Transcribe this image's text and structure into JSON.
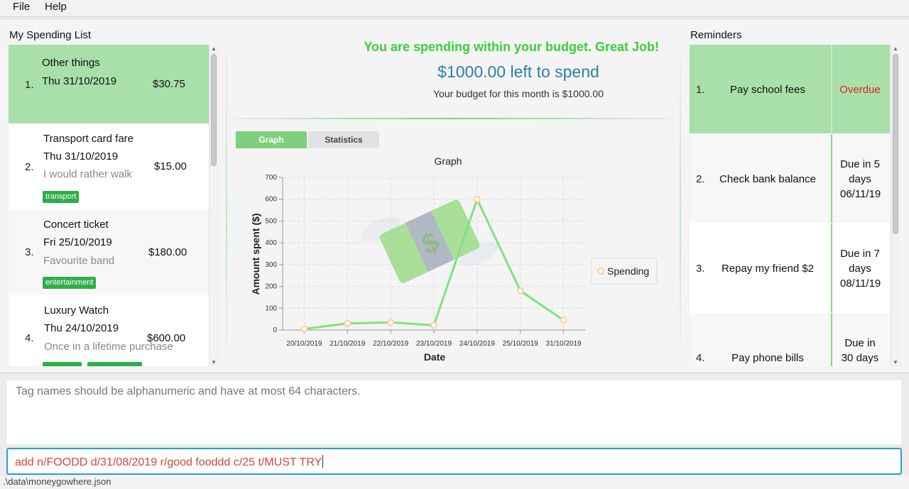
{
  "menu": {
    "file": "File",
    "help": "Help"
  },
  "spending": {
    "title": "My Spending List",
    "items": [
      {
        "index": "1.",
        "name": "Other things",
        "date": "Thu 31/10/2019",
        "remark": "",
        "cost": "$30.75",
        "tags": []
      },
      {
        "index": "2.",
        "name": "Transport card fare",
        "date": "Thu 31/10/2019",
        "remark": "I would rather walk",
        "cost": "$15.00",
        "tags": [
          "transport"
        ]
      },
      {
        "index": "3.",
        "name": "Concert ticket",
        "date": "Fri 25/10/2019",
        "remark": "Favourite band",
        "cost": "$180.00",
        "tags": [
          "entertainment"
        ]
      },
      {
        "index": "4.",
        "name": "Luxury Watch",
        "date": "Thu 24/10/2019",
        "remark": "Once in a lifetime purchase",
        "cost": "$600.00",
        "tags": []
      }
    ],
    "selected_color": "#a9dfa9",
    "tag_color": "#2eae4a"
  },
  "budget": {
    "status_message": "You are spending within your budget. Great Job!",
    "status_color": "#3ad13a",
    "left_to_spend": "$1000.00 left to spend",
    "left_color": "#2e7fa8",
    "budget_line": "Your budget for this month is $1000.00"
  },
  "tabs": {
    "graph": "Graph",
    "statistics": "Statistics",
    "active": "graph"
  },
  "chart_data": {
    "type": "line",
    "title": "Graph",
    "xlabel": "Date",
    "ylabel": "Amount spent ($)",
    "categories": [
      "20/10/2019",
      "21/10/2019",
      "22/10/2019",
      "23/10/2019",
      "24/10/2019",
      "25/10/2019",
      "31/10/2019"
    ],
    "series": [
      {
        "name": "Spending",
        "values": [
          5,
          30,
          35,
          22,
          600,
          180,
          45
        ]
      }
    ],
    "ylim": [
      0,
      700
    ],
    "yticks": [
      0,
      100,
      200,
      300,
      400,
      500,
      600,
      700
    ],
    "grid": true,
    "legend": "right",
    "line_color": "#7ee37e",
    "marker_color": "#ffcc99"
  },
  "reminders": {
    "title": "Reminders",
    "items": [
      {
        "index": "1.",
        "description": "Pay school fees",
        "status": "Overdue",
        "status_color": "#e02020"
      },
      {
        "index": "2.",
        "description": "Check bank balance",
        "status": "Due in 5 days 06/11/19",
        "status_color": "#111111"
      },
      {
        "index": "3.",
        "description": "Repay my friend $2",
        "status": "Due in 7 days 08/11/19",
        "status_color": "#111111"
      },
      {
        "index": "4.",
        "description": "Pay phone bills",
        "status": "Due in 30 days",
        "status_color": "#111111"
      }
    ]
  },
  "result": {
    "text": "Tag names should be alphanumeric and have at most 64 characters."
  },
  "command": {
    "value": "add n/FOODD d/31/08/2019 r/good fooddd c/25 t/MUST TRY"
  },
  "status_bar": {
    "path": ".\\data\\moneygowhere.json"
  }
}
